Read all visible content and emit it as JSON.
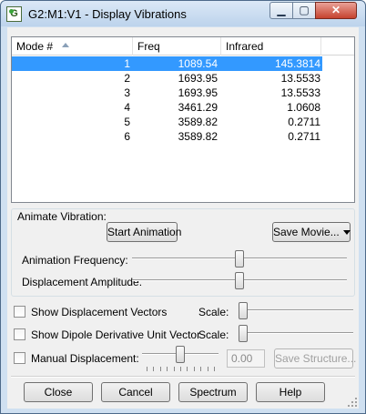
{
  "window": {
    "title": "G2:M1:V1 - Display Vibrations",
    "icon_glyph": "G",
    "min_glyph": "▁",
    "max_glyph": "▢",
    "close_glyph": "✕"
  },
  "table": {
    "columns": [
      "Mode #",
      "Freq",
      "Infrared"
    ],
    "rows": [
      {
        "mode": "1",
        "freq": "1089.54",
        "ir": "145.3814",
        "selected": true
      },
      {
        "mode": "2",
        "freq": "1693.95",
        "ir": "13.5533",
        "selected": false
      },
      {
        "mode": "3",
        "freq": "1693.95",
        "ir": "13.5533",
        "selected": false
      },
      {
        "mode": "4",
        "freq": "3461.29",
        "ir": "1.0608",
        "selected": false
      },
      {
        "mode": "5",
        "freq": "3589.82",
        "ir": "0.2711",
        "selected": false
      },
      {
        "mode": "6",
        "freq": "3589.82",
        "ir": "0.2711",
        "selected": false
      }
    ],
    "selected_color": "#3399ff"
  },
  "animate": {
    "group_label": "Animate Vibration:",
    "start_button": "Start Animation",
    "save_movie_button": "Save Movie...",
    "frequency_label": "Animation Frequency:",
    "frequency_level": 0.5,
    "amplitude_label": "Displacement Amplitude:",
    "amplitude_level": 0.5
  },
  "options": {
    "show_vectors_label": "Show Displacement Vectors",
    "show_vectors_checked": false,
    "show_dipole_label": "Show Dipole Derivative Unit Vector",
    "show_dipole_checked": false,
    "scale_label": "Scale:",
    "vectors_scale_level": 0.0,
    "dipole_scale_level": 0.0,
    "manual_label": "Manual Displacement:",
    "manual_checked": false,
    "manual_level": 0.5,
    "manual_value": "0.00",
    "save_structure_button": "Save Structure..."
  },
  "buttons": {
    "close": "Close",
    "cancel": "Cancel",
    "spectrum": "Spectrum",
    "help": "Help"
  }
}
